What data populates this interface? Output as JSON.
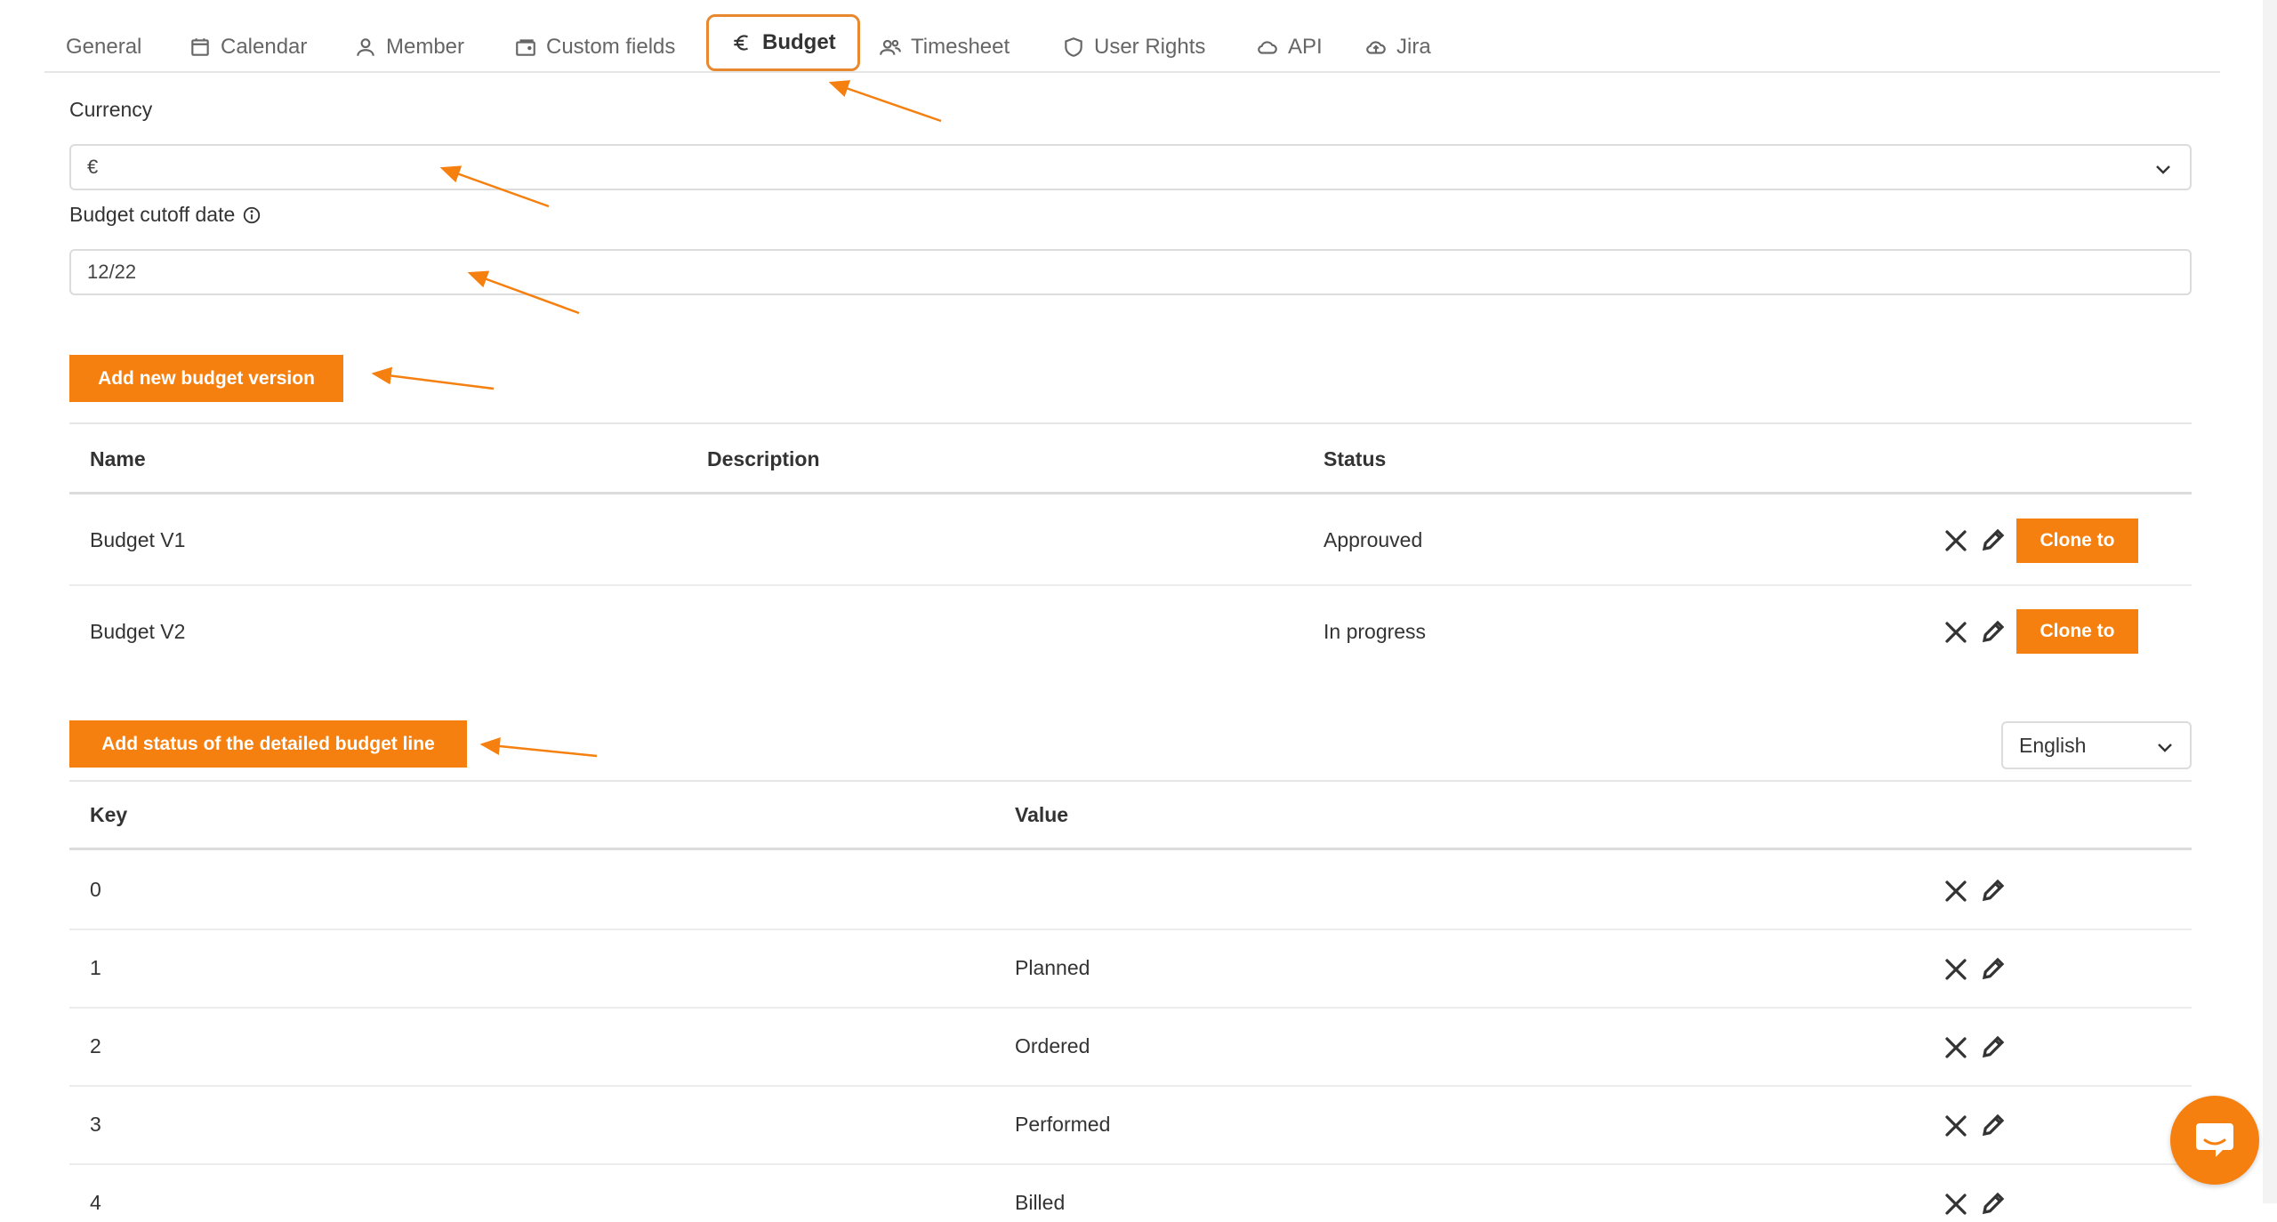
{
  "tabs": [
    {
      "label": "General",
      "icon": ""
    },
    {
      "label": "Calendar",
      "icon": "calendar-icon"
    },
    {
      "label": "Member",
      "icon": "user-icon"
    },
    {
      "label": "Custom fields",
      "icon": "folder-icon"
    },
    {
      "label": "Budget",
      "icon": "euro-icon",
      "active": true
    },
    {
      "label": "Timesheet",
      "icon": "users-icon"
    },
    {
      "label": "User Rights",
      "icon": "shield-icon"
    },
    {
      "label": "API",
      "icon": "cloud-icon"
    },
    {
      "label": "Jira",
      "icon": "cloud-upload-icon"
    }
  ],
  "form": {
    "currency_label": "Currency",
    "currency_value": "€",
    "cutoff_label": "Budget cutoff date",
    "cutoff_value": "12/22"
  },
  "versions": {
    "add_button": "Add new budget version",
    "headers": {
      "name": "Name",
      "description": "Description",
      "status": "Status"
    },
    "rows": [
      {
        "name": "Budget V1",
        "description": "",
        "status": "Approuved",
        "clone": "Clone to"
      },
      {
        "name": "Budget V2",
        "description": "",
        "status": "In progress",
        "clone": "Clone to"
      }
    ]
  },
  "statuses": {
    "add_button": "Add status of the detailed budget line",
    "language": "English",
    "headers": {
      "key": "Key",
      "value": "Value"
    },
    "rows": [
      {
        "key": "0",
        "value": ""
      },
      {
        "key": "1",
        "value": "Planned"
      },
      {
        "key": "2",
        "value": "Ordered"
      },
      {
        "key": "3",
        "value": "Performed"
      },
      {
        "key": "4",
        "value": "Billed"
      }
    ]
  },
  "colors": {
    "accent": "#f5800f",
    "active_tab_border": "#e8892f"
  }
}
